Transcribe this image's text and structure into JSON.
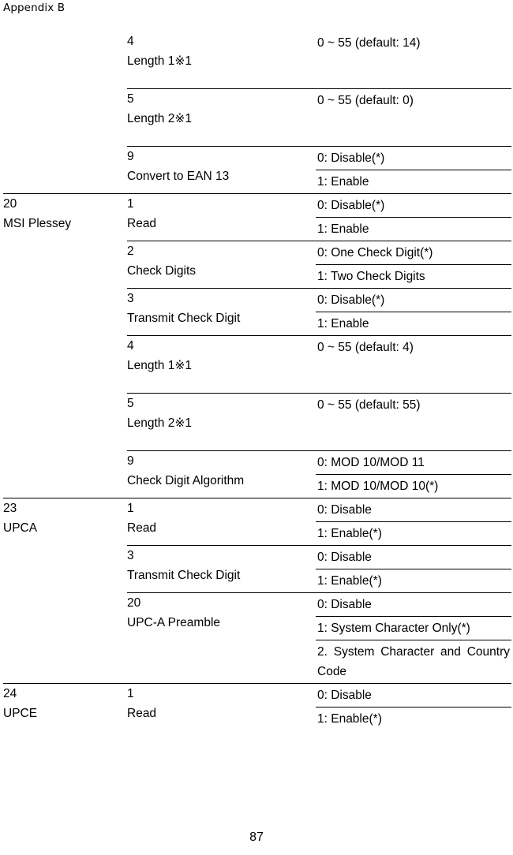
{
  "header": {
    "running_head": "Appendix B"
  },
  "footer": {
    "page_number": "87"
  },
  "table": {
    "rows": [
      {
        "code": "",
        "code_name": "",
        "item_num": "4",
        "item_name": "Length 1※1",
        "options": [
          "0 ~ 55 (default: 14)"
        ],
        "tall": true,
        "separator": "none"
      },
      {
        "code": "",
        "code_name": "",
        "item_num": "5",
        "item_name": "Length 2※1",
        "options": [
          "0 ~ 55 (default: 0)"
        ],
        "tall": true,
        "separator": "indent"
      },
      {
        "code": "",
        "code_name": "",
        "item_num": "9",
        "item_name": "Convert to EAN 13",
        "options": [
          "0: Disable(*)",
          "1: Enable"
        ],
        "tall": false,
        "separator": "indent"
      },
      {
        "code": "20",
        "code_name": "MSI Plessey",
        "item_num": "1",
        "item_name": "Read",
        "options": [
          "0: Disable(*)",
          "1: Enable"
        ],
        "tall": false,
        "separator": "full"
      },
      {
        "code": "",
        "code_name": "",
        "item_num": "2",
        "item_name": "Check Digits",
        "options": [
          "0: One Check Digit(*)",
          "1: Two Check Digits"
        ],
        "tall": false,
        "separator": "indent"
      },
      {
        "code": "",
        "code_name": "",
        "item_num": "3",
        "item_name": "Transmit Check Digit",
        "options": [
          "0: Disable(*)",
          "1: Enable"
        ],
        "tall": false,
        "separator": "indent"
      },
      {
        "code": "",
        "code_name": "",
        "item_num": "4",
        "item_name": "Length 1※1",
        "options": [
          "0 ~ 55 (default: 4)"
        ],
        "tall": true,
        "separator": "indent"
      },
      {
        "code": "",
        "code_name": "",
        "item_num": "5",
        "item_name": "Length 2※1",
        "options": [
          "0 ~ 55 (default: 55)"
        ],
        "tall": true,
        "separator": "indent"
      },
      {
        "code": "",
        "code_name": "",
        "item_num": "9",
        "item_name": "Check Digit Algorithm",
        "options": [
          "0: MOD 10/MOD 11",
          "1: MOD 10/MOD 10(*)"
        ],
        "tall": false,
        "separator": "indent"
      },
      {
        "code": "23",
        "code_name": "UPCA",
        "item_num": "1",
        "item_name": "Read",
        "options": [
          "0: Disable",
          "1: Enable(*)"
        ],
        "tall": false,
        "separator": "full"
      },
      {
        "code": "",
        "code_name": "",
        "item_num": "3",
        "item_name": "Transmit Check Digit",
        "options": [
          "0: Disable",
          "1: Enable(*)"
        ],
        "tall": false,
        "separator": "indent"
      },
      {
        "code": "",
        "code_name": "",
        "item_num": "20",
        "item_name": "UPC-A Preamble",
        "options": [
          "0: Disable",
          "1: System Character Only(*)",
          "2. System Character and Country Code"
        ],
        "justified": [
          false,
          true,
          true
        ],
        "tall": false,
        "separator": "indent"
      },
      {
        "code": "24",
        "code_name": "UPCE",
        "item_num": "1",
        "item_name": "Read",
        "options": [
          "0: Disable",
          "1: Enable(*)"
        ],
        "tall": false,
        "separator": "full"
      }
    ]
  }
}
